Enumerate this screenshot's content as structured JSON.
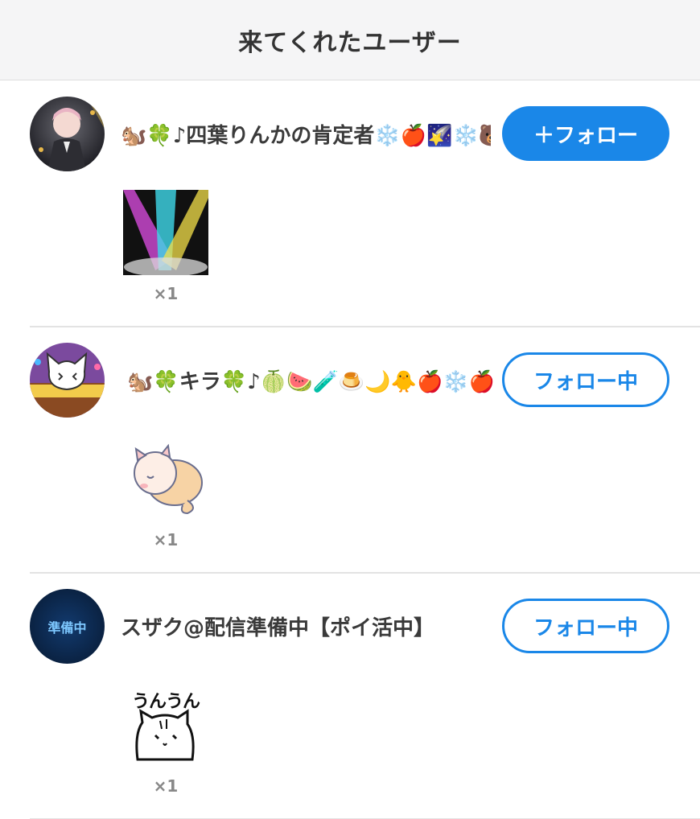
{
  "header": {
    "title": "来てくれたユーザー"
  },
  "users": [
    {
      "name": "🐿️🍀♪四葉りんかの肯定者❄️🍎🌠❄️🐻",
      "button_label": "＋フォロー",
      "button_state": "follow",
      "gift_icon": "spotlight-stage-icon",
      "gift_count": "×1"
    },
    {
      "name": "🐿️🍀キラ🍀♪🍈🍉🧪🍮🌙🐥🍎❄️🍎🐰🌸",
      "button_label": "フォロー中",
      "button_state": "following",
      "gift_icon": "sleeping-cat-icon",
      "gift_count": "×1"
    },
    {
      "name": "スザク@配信準備中【ポイ活中】",
      "button_label": "フォロー中",
      "button_state": "following",
      "avatar_text": "準備中",
      "gift_icon": "unun-cat-sticker-icon",
      "gift_text": "うんうん",
      "gift_count": "×1"
    }
  ],
  "colors": {
    "accent": "#1a87e8",
    "header_bg": "#f5f5f6",
    "divider": "#e3e3e3"
  }
}
